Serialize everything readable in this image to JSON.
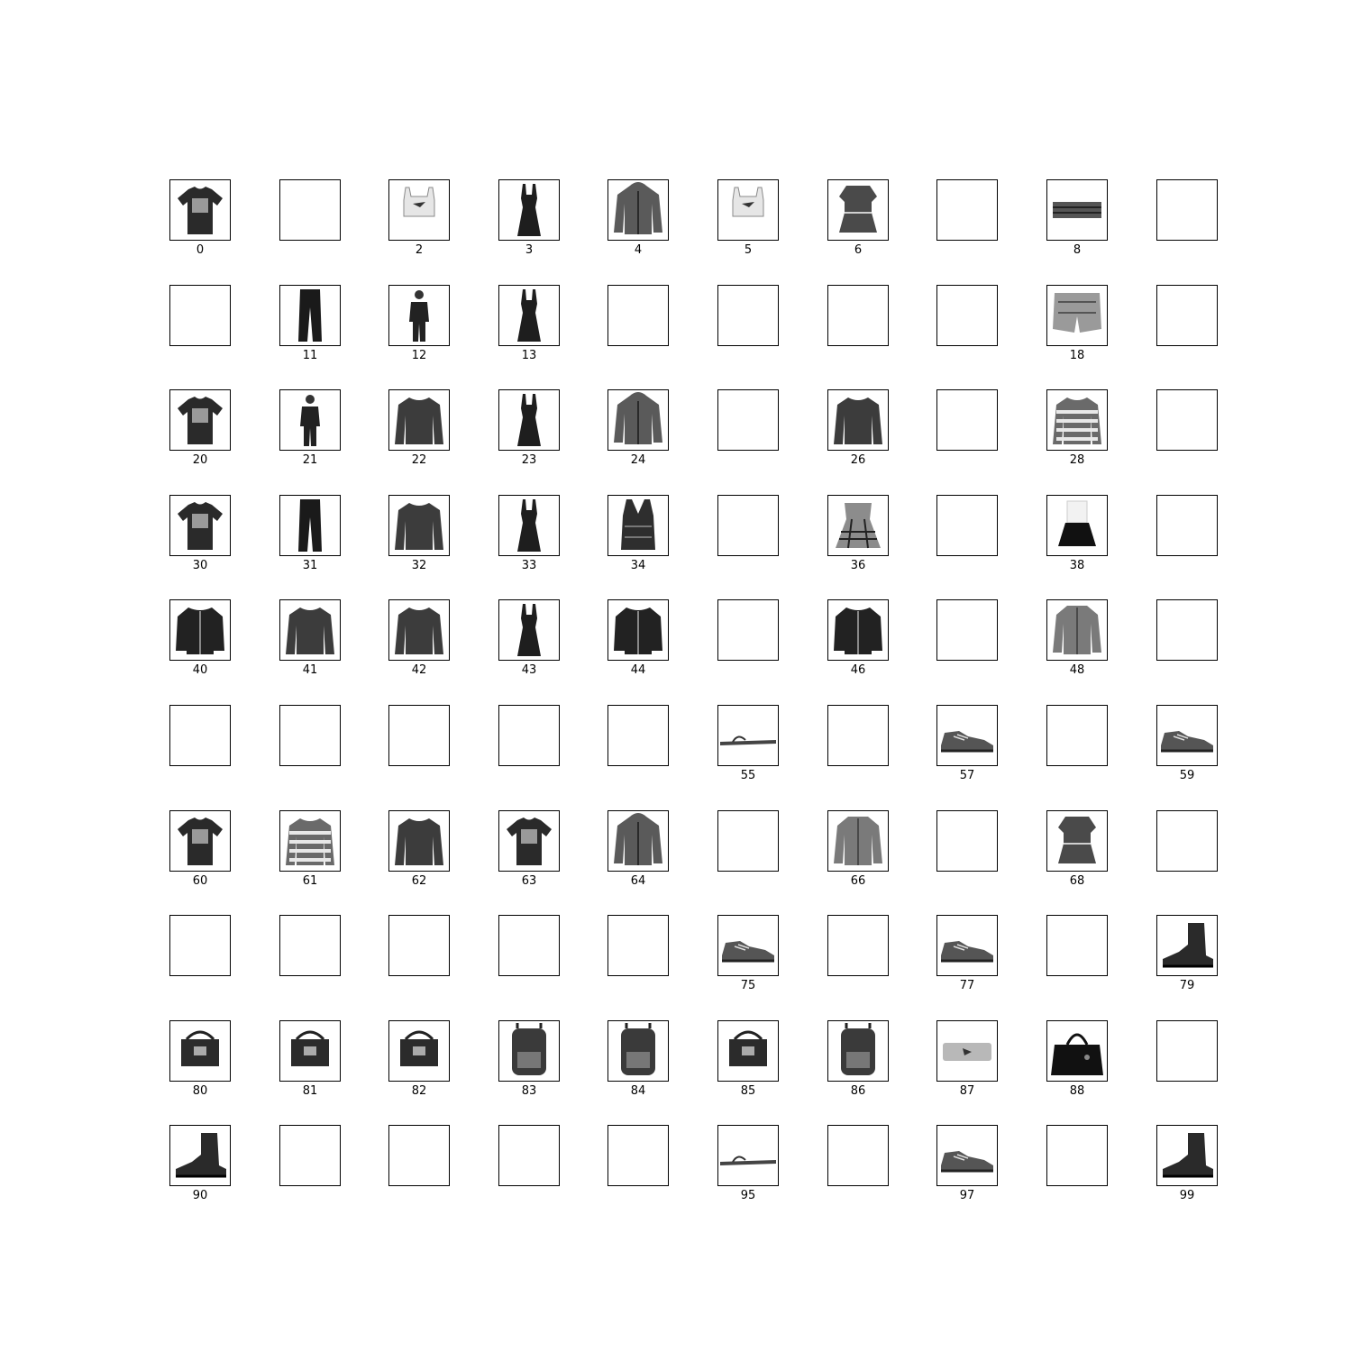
{
  "figure": {
    "background": "#ffffff",
    "frame_color": "#000000",
    "columns": 10,
    "rows": 10
  },
  "items": [
    {
      "label": "0",
      "icon": "tshirt-icon"
    },
    {
      "label": "",
      "icon": "empty"
    },
    {
      "label": "2",
      "icon": "crop-top-icon"
    },
    {
      "label": "3",
      "icon": "dress-icon"
    },
    {
      "label": "4",
      "icon": "hoodie-icon"
    },
    {
      "label": "5",
      "icon": "crop-top-icon"
    },
    {
      "label": "6",
      "icon": "blouse-icon"
    },
    {
      "label": "",
      "icon": "empty"
    },
    {
      "label": "8",
      "icon": "tube-top-icon"
    },
    {
      "label": "",
      "icon": "empty"
    },
    {
      "label": "",
      "icon": "empty"
    },
    {
      "label": "11",
      "icon": "trousers-icon"
    },
    {
      "label": "12",
      "icon": "person-icon"
    },
    {
      "label": "13",
      "icon": "dress-icon"
    },
    {
      "label": "",
      "icon": "empty"
    },
    {
      "label": "",
      "icon": "empty"
    },
    {
      "label": "",
      "icon": "empty"
    },
    {
      "label": "",
      "icon": "empty"
    },
    {
      "label": "18",
      "icon": "shorts-icon"
    },
    {
      "label": "",
      "icon": "empty"
    },
    {
      "label": "20",
      "icon": "tshirt-icon"
    },
    {
      "label": "21",
      "icon": "person-icon"
    },
    {
      "label": "22",
      "icon": "sweater-icon"
    },
    {
      "label": "23",
      "icon": "dress-icon"
    },
    {
      "label": "24",
      "icon": "hoodie-icon"
    },
    {
      "label": "",
      "icon": "empty"
    },
    {
      "label": "26",
      "icon": "sweater-icon"
    },
    {
      "label": "",
      "icon": "empty"
    },
    {
      "label": "28",
      "icon": "striped-sweater-icon"
    },
    {
      "label": "",
      "icon": "empty"
    },
    {
      "label": "30",
      "icon": "tshirt-icon"
    },
    {
      "label": "31",
      "icon": "trousers-icon"
    },
    {
      "label": "32",
      "icon": "sweater-icon"
    },
    {
      "label": "33",
      "icon": "dress-icon"
    },
    {
      "label": "34",
      "icon": "vest-icon"
    },
    {
      "label": "",
      "icon": "empty"
    },
    {
      "label": "36",
      "icon": "plaid-dress-icon"
    },
    {
      "label": "",
      "icon": "empty"
    },
    {
      "label": "38",
      "icon": "skirt-icon"
    },
    {
      "label": "",
      "icon": "empty"
    },
    {
      "label": "40",
      "icon": "jacket-icon"
    },
    {
      "label": "41",
      "icon": "sweater-icon"
    },
    {
      "label": "42",
      "icon": "sweater-icon"
    },
    {
      "label": "43",
      "icon": "dress-icon"
    },
    {
      "label": "44",
      "icon": "jacket-icon"
    },
    {
      "label": "",
      "icon": "empty"
    },
    {
      "label": "46",
      "icon": "jacket-icon"
    },
    {
      "label": "",
      "icon": "empty"
    },
    {
      "label": "48",
      "icon": "shirt-icon"
    },
    {
      "label": "",
      "icon": "empty"
    },
    {
      "label": "",
      "icon": "empty"
    },
    {
      "label": "",
      "icon": "empty"
    },
    {
      "label": "",
      "icon": "empty"
    },
    {
      "label": "",
      "icon": "empty"
    },
    {
      "label": "",
      "icon": "empty"
    },
    {
      "label": "55",
      "icon": "sandal-icon"
    },
    {
      "label": "",
      "icon": "empty"
    },
    {
      "label": "57",
      "icon": "sneaker-icon"
    },
    {
      "label": "",
      "icon": "empty"
    },
    {
      "label": "59",
      "icon": "sneaker-icon"
    },
    {
      "label": "60",
      "icon": "tshirt-icon"
    },
    {
      "label": "61",
      "icon": "striped-sweater-icon"
    },
    {
      "label": "62",
      "icon": "sweater-icon"
    },
    {
      "label": "63",
      "icon": "tshirt-icon"
    },
    {
      "label": "64",
      "icon": "hoodie-icon"
    },
    {
      "label": "",
      "icon": "empty"
    },
    {
      "label": "66",
      "icon": "shirt-icon"
    },
    {
      "label": "",
      "icon": "empty"
    },
    {
      "label": "68",
      "icon": "blouse-icon"
    },
    {
      "label": "",
      "icon": "empty"
    },
    {
      "label": "",
      "icon": "empty"
    },
    {
      "label": "",
      "icon": "empty"
    },
    {
      "label": "",
      "icon": "empty"
    },
    {
      "label": "",
      "icon": "empty"
    },
    {
      "label": "",
      "icon": "empty"
    },
    {
      "label": "75",
      "icon": "sneaker-icon"
    },
    {
      "label": "",
      "icon": "empty"
    },
    {
      "label": "77",
      "icon": "sneaker-icon"
    },
    {
      "label": "",
      "icon": "empty"
    },
    {
      "label": "79",
      "icon": "boot-icon"
    },
    {
      "label": "80",
      "icon": "bag-icon"
    },
    {
      "label": "81",
      "icon": "bag-icon"
    },
    {
      "label": "82",
      "icon": "bag-icon"
    },
    {
      "label": "83",
      "icon": "backpack-icon"
    },
    {
      "label": "84",
      "icon": "backpack-icon"
    },
    {
      "label": "85",
      "icon": "bag-icon"
    },
    {
      "label": "86",
      "icon": "backpack-icon"
    },
    {
      "label": "87",
      "icon": "clutch-icon"
    },
    {
      "label": "88",
      "icon": "handbag-icon"
    },
    {
      "label": "",
      "icon": "empty"
    },
    {
      "label": "90",
      "icon": "boot-icon"
    },
    {
      "label": "",
      "icon": "empty"
    },
    {
      "label": "",
      "icon": "empty"
    },
    {
      "label": "",
      "icon": "empty"
    },
    {
      "label": "",
      "icon": "empty"
    },
    {
      "label": "95",
      "icon": "sandal-icon"
    },
    {
      "label": "",
      "icon": "empty"
    },
    {
      "label": "97",
      "icon": "sneaker-icon"
    },
    {
      "label": "",
      "icon": "empty"
    },
    {
      "label": "99",
      "icon": "boot-icon"
    }
  ]
}
